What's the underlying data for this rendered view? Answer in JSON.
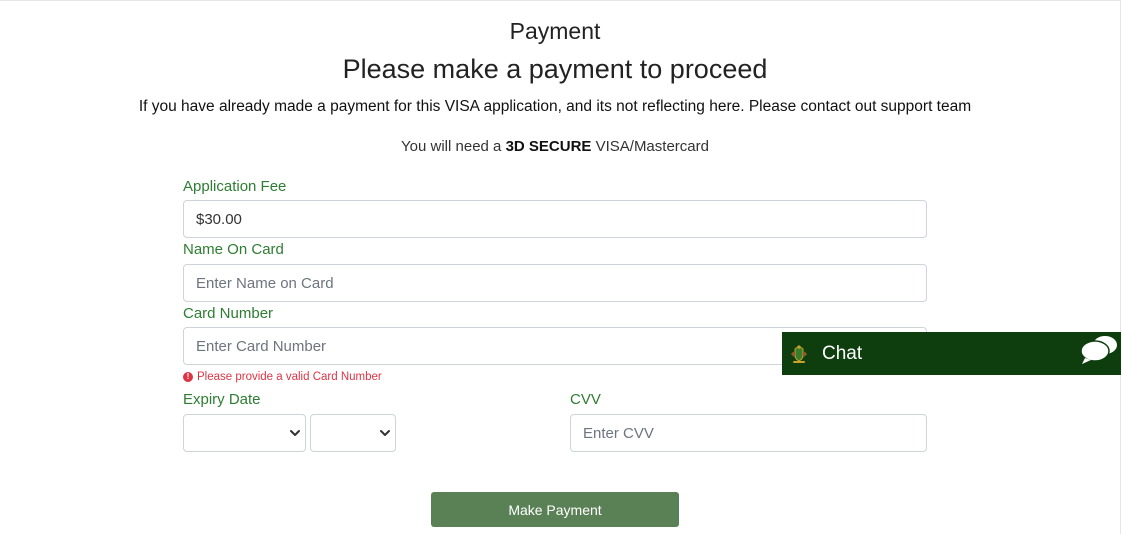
{
  "page": {
    "title": "Payment",
    "heading": "Please make a payment to proceed",
    "notice": "If you have already made a payment for this VISA application, and its not reflecting here. Please contact out support team",
    "requirement": {
      "prefix": "You will need a ",
      "emphasis": "3D SECURE",
      "suffix": " VISA/Mastercard"
    }
  },
  "form": {
    "application_fee": {
      "label": "Application Fee",
      "value": "$30.00"
    },
    "name_on_card": {
      "label": "Name On Card",
      "placeholder": "Enter Name on Card"
    },
    "card_number": {
      "label": "Card Number",
      "placeholder": "Enter Card Number",
      "error": "Please provide a valid Card Number"
    },
    "expiry_date": {
      "label": "Expiry Date",
      "month_value": "",
      "year_value": ""
    },
    "cvv": {
      "label": "CVV",
      "placeholder": "Enter CVV"
    },
    "submit_label": "Make Payment"
  },
  "chat": {
    "label": "Chat",
    "logo_icon": "coat-of-arms-icon",
    "bubble_icon": "chat-bubble-icon"
  },
  "colors": {
    "label_green": "#2e7d32",
    "button_green": "#5a8055",
    "chat_bar": "#0e3d0e",
    "error_red": "#dc3545"
  }
}
